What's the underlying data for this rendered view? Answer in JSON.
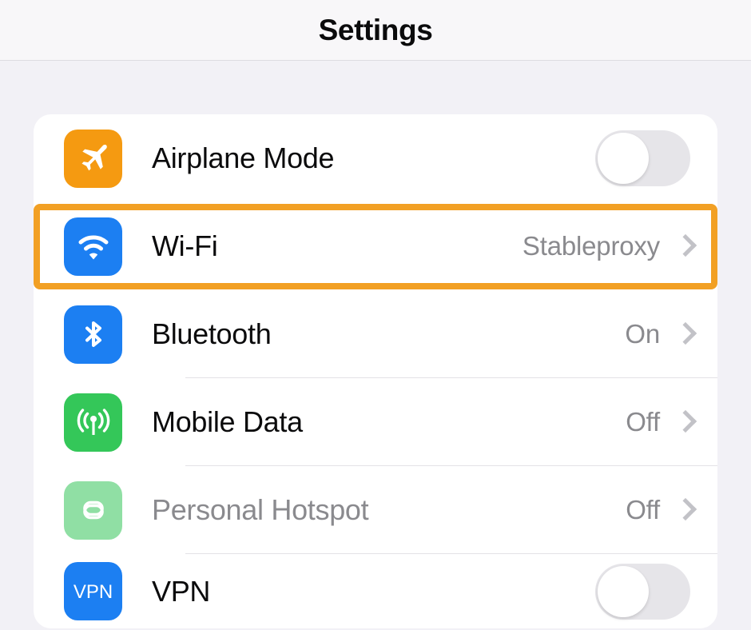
{
  "header": {
    "title": "Settings"
  },
  "highlight": {
    "color": "#f2a024",
    "target_row": "wifi"
  },
  "colors": {
    "page_background": "#f2f1f6",
    "card_background": "#ffffff",
    "label": "#0b0b0c",
    "value": "#8a8a8e",
    "chevron": "#c2c2c7",
    "toggle_off_track": "#e6e5e9",
    "toggle_knob": "#ffffff",
    "divider": "#e3e2e6"
  },
  "settings_list": {
    "rows": [
      {
        "key": "airplane-mode",
        "label": "Airplane Mode",
        "icon": "airplane-icon",
        "icon_color": "#f59a11",
        "accessory": "toggle",
        "toggle_state": "off",
        "value": "",
        "disabled": false,
        "divider": false
      },
      {
        "key": "wifi",
        "label": "Wi-Fi",
        "icon": "wifi-icon",
        "icon_color": "#1c7ff2",
        "accessory": "chevron",
        "value": "Stableproxy",
        "disabled": false,
        "divider": false
      },
      {
        "key": "bluetooth",
        "label": "Bluetooth",
        "icon": "bluetooth-icon",
        "icon_color": "#1c7ff2",
        "accessory": "chevron",
        "value": "On",
        "disabled": false,
        "divider": true
      },
      {
        "key": "mobile-data",
        "label": "Mobile Data",
        "icon": "cellular-antenna-icon",
        "icon_color": "#34c759",
        "accessory": "chevron",
        "value": "Off",
        "disabled": false,
        "divider": true
      },
      {
        "key": "personal-hotspot",
        "label": "Personal Hotspot",
        "icon": "hotspot-link-icon",
        "icon_color": "#90dfa4",
        "accessory": "chevron",
        "value": "Off",
        "disabled": true,
        "divider": true
      },
      {
        "key": "vpn",
        "label": "VPN",
        "icon": "vpn-icon",
        "icon_color": "#1c7ff2",
        "icon_text": "VPN",
        "accessory": "toggle",
        "toggle_state": "off",
        "value": "",
        "disabled": false,
        "divider": false
      }
    ]
  }
}
